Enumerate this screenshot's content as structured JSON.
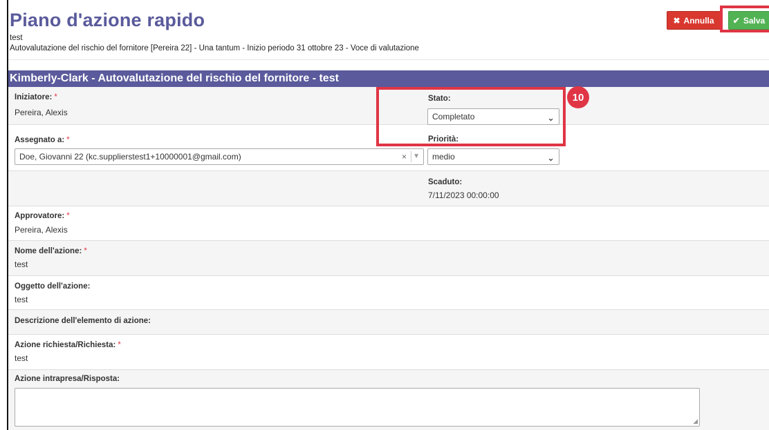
{
  "page": {
    "title": "Piano d'azione rapido",
    "subtitle": "test",
    "breadcrumb": "Autovalutazione del rischio del fornitore [Pereira 22] - Una tantum - Inizio periodo 31 ottobre 23 - Voce di valutazione"
  },
  "toolbar": {
    "cancel_label": "Annulla",
    "save_label": "Salva"
  },
  "section": {
    "header": "Kimberly-Clark - Autovalutazione del rischio del fornitore - test"
  },
  "form": {
    "initiator_label": "Iniziatore:",
    "initiator_value": "Pereira, Alexis",
    "status_label": "Stato:",
    "status_value": "Completato",
    "assigned_label": "Assegnato a:",
    "assigned_value": "Doe, Giovanni 22 (kc.supplierstest1+10000001@gmail.com)",
    "priority_label": "Priorità:",
    "priority_value": "medio",
    "due_label": "Scaduto:",
    "due_value": "7/11/2023 00:00:00",
    "approver_label": "Approvatore:",
    "approver_value": "Pereira, Alexis",
    "action_name_label": "Nome dell'azione:",
    "action_name_value": "test",
    "action_subject_label": "Oggetto dell'azione:",
    "action_subject_value": "test",
    "action_desc_label": "Descrizione dell'elemento di azione:",
    "action_requested_label": "Azione richiesta/Richiesta:",
    "action_requested_value": "test",
    "action_taken_label": "Azione intrapresa/Risposta:",
    "required_mark": "*"
  },
  "annotation": {
    "step_number": "10"
  },
  "colors": {
    "header": "#5a5a9c",
    "highlight": "#e03545",
    "cancel": "#d9382f",
    "save": "#52b354"
  }
}
